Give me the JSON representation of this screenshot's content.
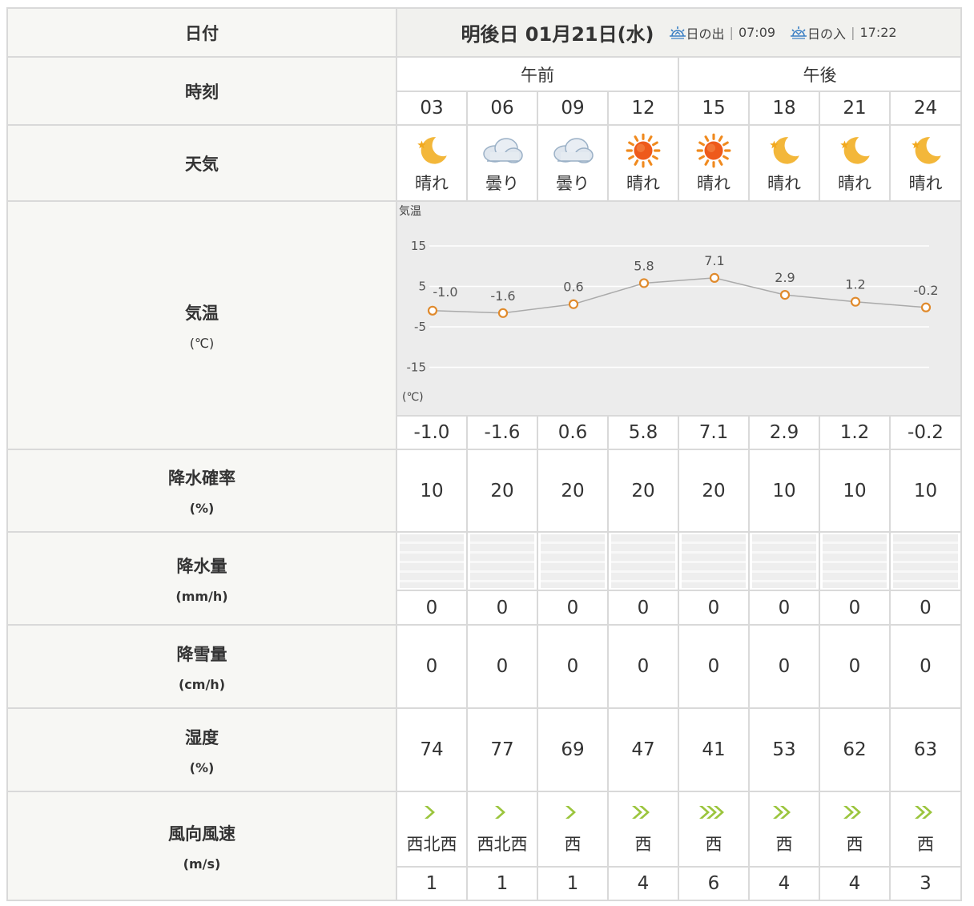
{
  "labels": {
    "date": "日付",
    "time": "時刻",
    "weather": "天気",
    "temp": "気温",
    "temp_unit": "(℃)",
    "precip_prob": "降水確率",
    "precip_prob_unit": "(%)",
    "precip_amount": "降水量",
    "precip_amount_unit": "(mm/h)",
    "snow": "降雪量",
    "snow_unit": "(cm/h)",
    "humidity": "湿度",
    "humidity_unit": "(%)",
    "wind": "風向風速",
    "wind_unit": "(m/s)"
  },
  "header": {
    "date_text": "明後日 01月21日(水)",
    "sunrise_label": "日の出",
    "sunrise_time": "07:09",
    "sunset_label": "日の入",
    "sunset_time": "17:22"
  },
  "period": {
    "am": "午前",
    "pm": "午後"
  },
  "hours": [
    "03",
    "06",
    "09",
    "12",
    "15",
    "18",
    "21",
    "24"
  ],
  "weather": [
    {
      "icon": "moon-icon",
      "text": "晴れ"
    },
    {
      "icon": "cloud-icon",
      "text": "曇り"
    },
    {
      "icon": "cloud-icon",
      "text": "曇り"
    },
    {
      "icon": "sun-icon",
      "text": "晴れ"
    },
    {
      "icon": "sun-icon",
      "text": "晴れ"
    },
    {
      "icon": "moon-icon",
      "text": "晴れ"
    },
    {
      "icon": "moon-icon",
      "text": "晴れ"
    },
    {
      "icon": "moon-icon",
      "text": "晴れ"
    }
  ],
  "temperature": [
    "-1.0",
    "-1.6",
    "0.6",
    "5.8",
    "7.1",
    "2.9",
    "1.2",
    "-0.2"
  ],
  "precip_prob": [
    "10",
    "20",
    "20",
    "20",
    "20",
    "10",
    "10",
    "10"
  ],
  "precip_amount": [
    "0",
    "0",
    "0",
    "0",
    "0",
    "0",
    "0",
    "0"
  ],
  "snow": [
    "0",
    "0",
    "0",
    "0",
    "0",
    "0",
    "0",
    "0"
  ],
  "humidity": [
    "74",
    "77",
    "69",
    "47",
    "41",
    "53",
    "62",
    "63"
  ],
  "wind": [
    {
      "dir": "西北西",
      "speed": "1",
      "level": 1
    },
    {
      "dir": "西北西",
      "speed": "1",
      "level": 1
    },
    {
      "dir": "西",
      "speed": "1",
      "level": 1
    },
    {
      "dir": "西",
      "speed": "4",
      "level": 2
    },
    {
      "dir": "西",
      "speed": "6",
      "level": 3
    },
    {
      "dir": "西",
      "speed": "4",
      "level": 2
    },
    {
      "dir": "西",
      "speed": "4",
      "level": 2
    },
    {
      "dir": "西",
      "speed": "3",
      "level": 2
    }
  ],
  "colors": {
    "line": "#aaaaaa",
    "marker": "#e08a2c",
    "chart_bg": "#ececec",
    "wind_icon": "#9bc53d"
  },
  "chart_data": {
    "type": "line",
    "title": "気温",
    "ylabel": "(℃)",
    "x": [
      "03",
      "06",
      "09",
      "12",
      "15",
      "18",
      "21",
      "24"
    ],
    "values": [
      -1.0,
      -1.6,
      0.6,
      5.8,
      7.1,
      2.9,
      1.2,
      -0.2
    ],
    "y_ticks": [
      "15",
      "5",
      "-5",
      "-15"
    ],
    "ylim": [
      -20,
      20
    ],
    "grid": true
  }
}
